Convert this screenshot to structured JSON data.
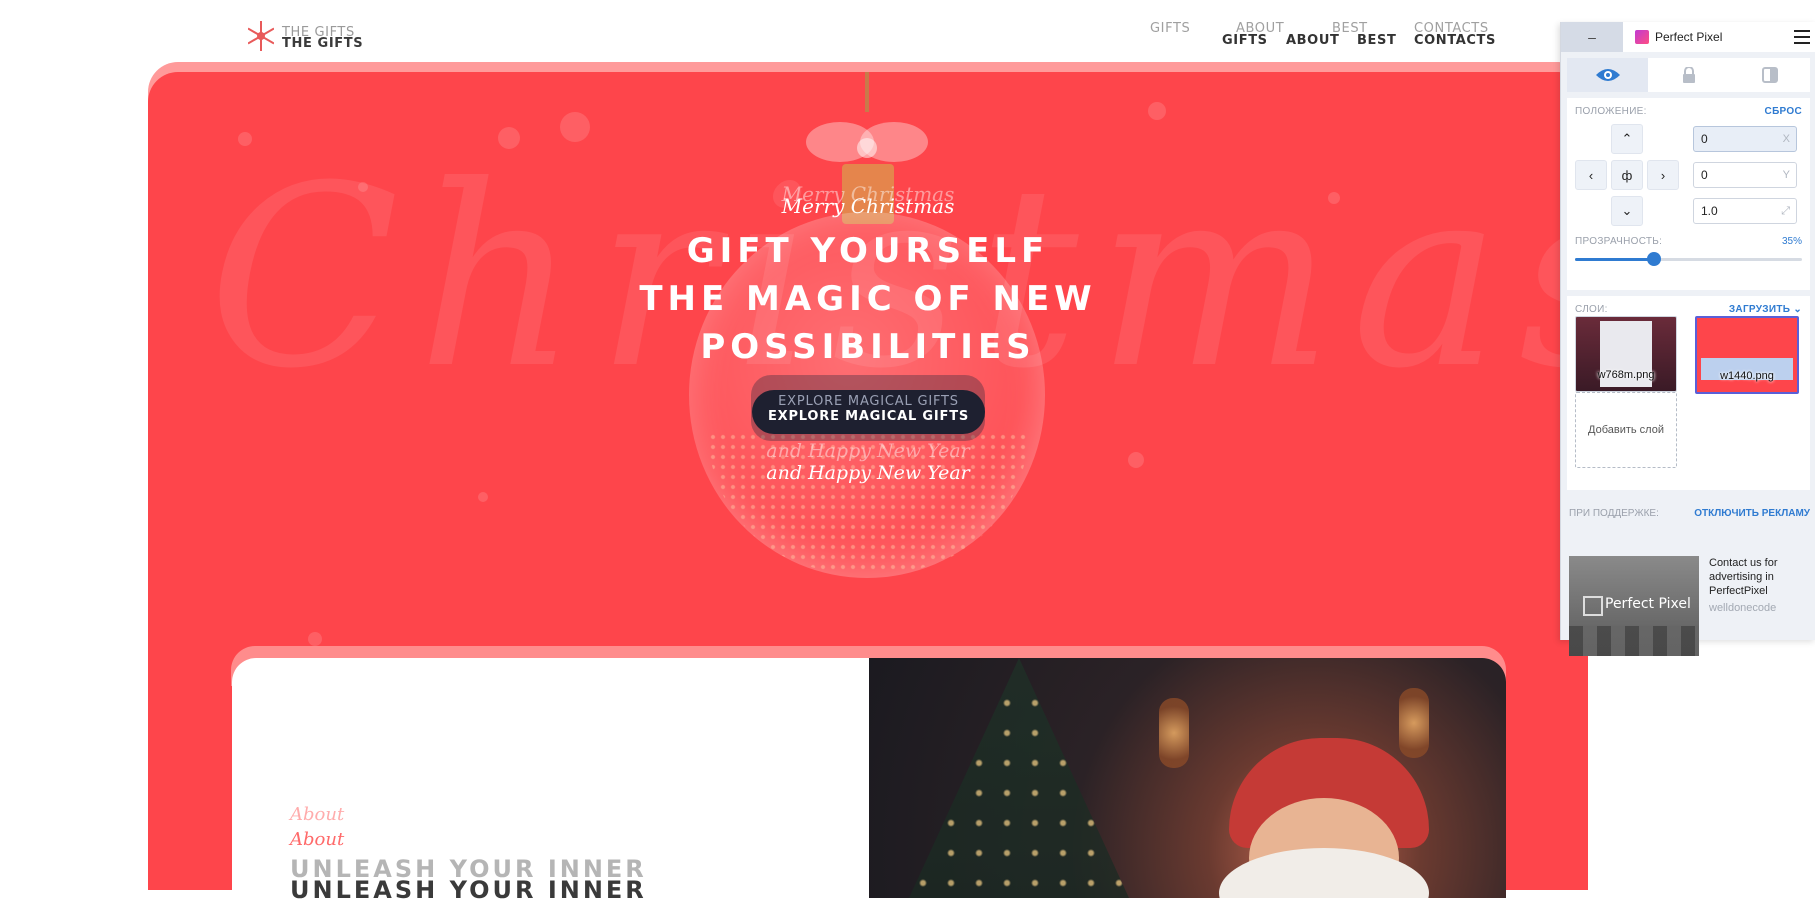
{
  "header": {
    "logo_ghost": "THE GIFTS",
    "logo_solid": "THE GIFTS",
    "nav_ghost": [
      "GIFTS",
      "ABOUT",
      "BEST",
      "CONTACTS"
    ],
    "nav_solid": [
      "GIFTS",
      "ABOUT",
      "BEST",
      "CONTACTS"
    ]
  },
  "hero": {
    "merry_ghost": "Merry Christmas",
    "merry": "Merry Christmas",
    "headline": [
      "GIFT YOURSELF",
      "THE MAGIC OF NEW",
      "POSSIBILITIES"
    ],
    "cta_ghost": "EXPLORE MAGICAL GIFTS",
    "cta": "EXPLORE MAGICAL GIFTS",
    "happy_ghost": "and Happy New Year",
    "happy": "and Happy New Year",
    "bg_word": "Christmas"
  },
  "about": {
    "small_ghost": "About",
    "small": "About",
    "heading_ghost": "UNLEASH YOUR INNER",
    "heading": "UNLEASH YOUR INNER"
  },
  "perfect_pixel": {
    "minimize": "–",
    "brand": "Perfect Pixel",
    "position_label": "ПОЛОЖЕНИЕ:",
    "reset": "СБРОС",
    "x_value": "0",
    "y_value": "0",
    "scale_value": "1.0",
    "x_suffix": "X",
    "y_suffix": "Y",
    "center_symbol": "ф",
    "opacity_label": "ПРОЗРАЧНОСТЬ:",
    "opacity_value": "35%",
    "opacity_fraction": 0.35,
    "layers_label": "СЛОИ:",
    "upload": "ЗАГРУЗИТЬ",
    "layers": [
      "w768m.png",
      "w1440.png"
    ],
    "add_layer": "Добавить слой",
    "support_label": "ПРИ ПОДДЕРЖКЕ:",
    "disable_ads": "ОТКЛЮЧИТЬ РЕКЛАМУ",
    "ad_image_text": "Perfect Pixel",
    "ad_text": "Contact us for advertising in PerfectPixel",
    "ad_sub": "welldonecode"
  },
  "colors": {
    "hero_red": "#fe454b",
    "cta_dark": "#1e2030",
    "pp_accent": "#2f7bd1"
  }
}
